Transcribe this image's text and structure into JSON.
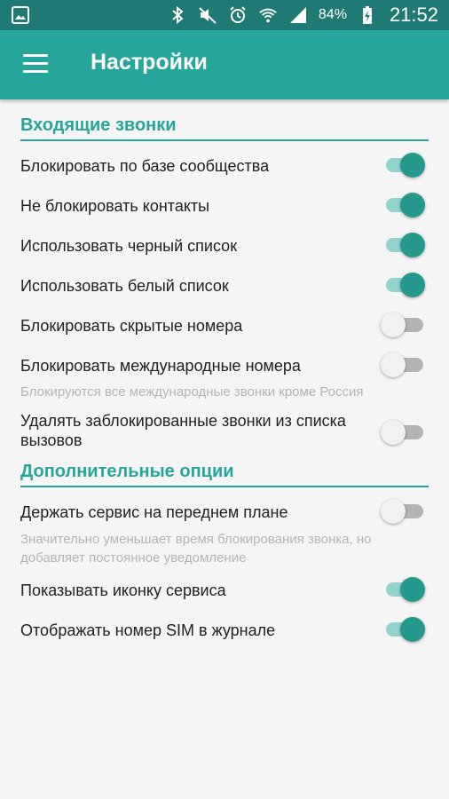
{
  "status_bar": {
    "icons": [
      "image-icon",
      "bluetooth-icon",
      "mute-icon",
      "alarm-icon",
      "wifi-icon",
      "signal-icon",
      "battery-icon"
    ],
    "battery": "84%",
    "time": "21:52"
  },
  "app_bar": {
    "title": "Настройки",
    "menu_icon": "menu-icon"
  },
  "accent_color": "#26a69a",
  "sections": [
    {
      "header": "Входящие звонки",
      "items": [
        {
          "title": "Блокировать по базе сообщества",
          "enabled": true
        },
        {
          "title": "Не блокировать контакты",
          "enabled": true
        },
        {
          "title": "Использовать черный список",
          "enabled": true
        },
        {
          "title": "Использовать белый список",
          "enabled": true
        },
        {
          "title": "Блокировать скрытые номера",
          "enabled": false
        },
        {
          "title": "Блокировать международные номера",
          "summary": "Блокируются все международные звонки кроме Россия",
          "enabled": false
        },
        {
          "title": "Удалять заблокированные звонки из списка вызовов",
          "enabled": false
        }
      ]
    },
    {
      "header": "Дополнительные опции",
      "items": [
        {
          "title": "Держать сервис на переднем плане",
          "summary": "Значительно уменьшает время блокирования звонка, но добавляет постоянное уведомление",
          "enabled": false
        },
        {
          "title": "Показывать иконку сервиса",
          "enabled": true
        },
        {
          "title": "Отображать номер SIM в журнале",
          "enabled": true
        }
      ]
    }
  ]
}
